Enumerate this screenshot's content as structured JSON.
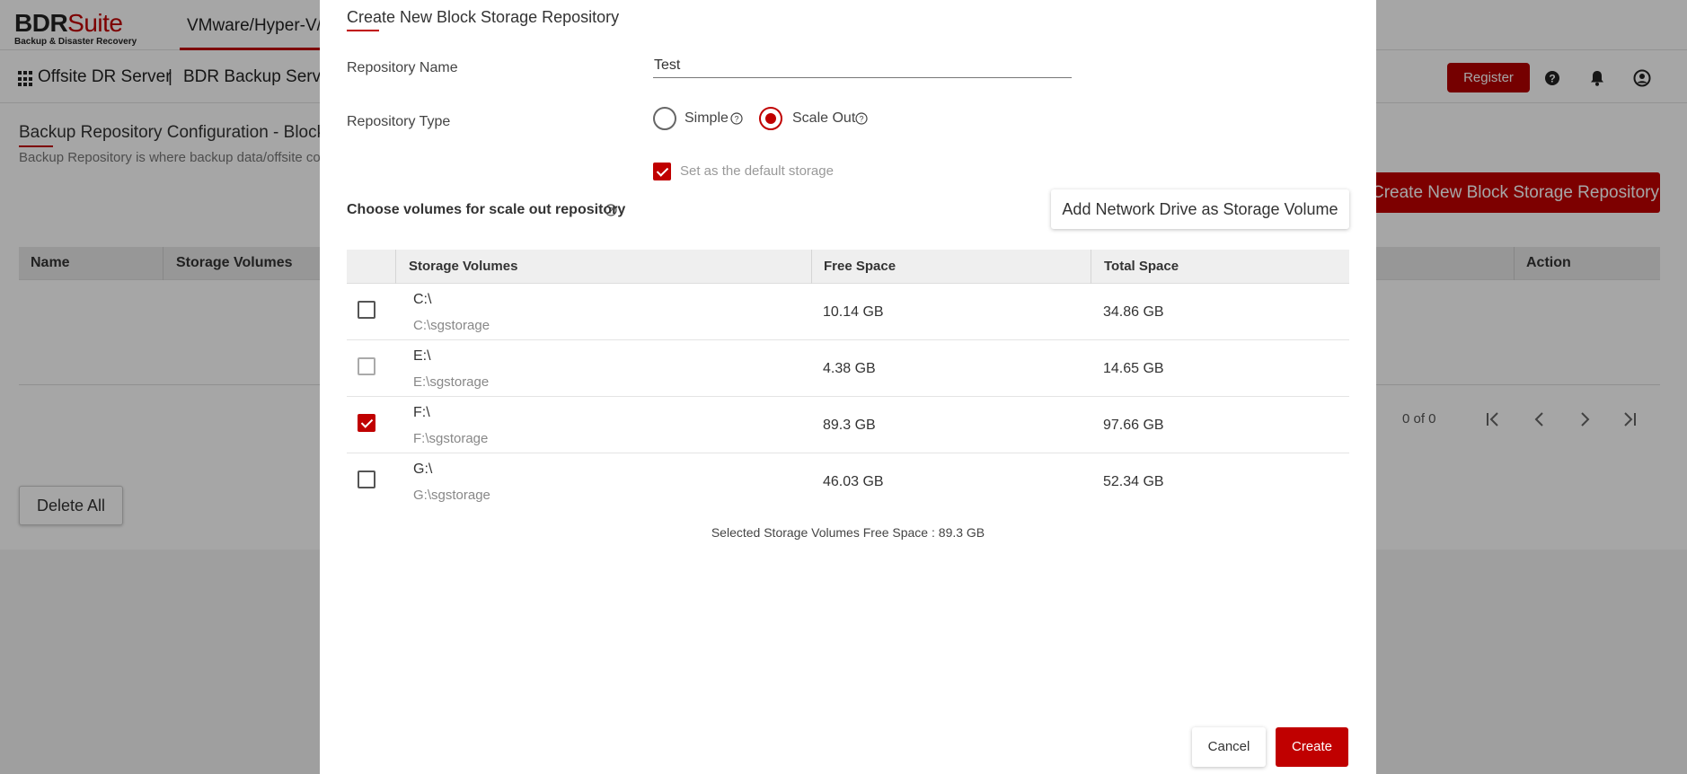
{
  "app": {
    "logo_main": "BDR",
    "logo_suite": "Suite",
    "logo_sub": "Backup & Disaster Recovery",
    "main_tab": "VMware/Hyper-V/W"
  },
  "subbar": {
    "crumb_1": "Offsite DR Server",
    "separator": "|",
    "crumb_2": "BDR Backup Servers",
    "register_label": "Register"
  },
  "background_page": {
    "title": "Backup Repository Configuration - Block Sto",
    "description": "Backup Repository is where backup data/offsite cop",
    "create_button_label": "Create New Block Storage Repository",
    "table_headers": [
      "Name",
      "Storage Volumes",
      "Action"
    ],
    "pager_count": "0 of 0",
    "delete_all_label": "Delete All"
  },
  "dialog": {
    "title": "Create New Block Storage Repository",
    "repository_name_label": "Repository Name",
    "repository_name_value": "Test",
    "repository_type_label": "Repository Type",
    "type_options": [
      {
        "label": "Simple",
        "selected": false
      },
      {
        "label": "Scale Out",
        "selected": true
      }
    ],
    "default_storage_label": "Set as the default storage",
    "default_storage_checked": true,
    "choose_volumes_label": "Choose volumes for scale out repository",
    "add_network_drive_label": "Add Network Drive as Storage Volume",
    "table_headers": {
      "storage_volumes": "Storage Volumes",
      "free_space": "Free Space",
      "total_space": "Total Space"
    },
    "volumes": [
      {
        "drive": "C:\\",
        "path": "C:\\sgstorage",
        "free": "10.14 GB",
        "total": "34.86 GB",
        "checked": false
      },
      {
        "drive": "E:\\",
        "path": "E:\\sgstorage",
        "free": "4.38 GB",
        "total": "14.65 GB",
        "checked": false
      },
      {
        "drive": "F:\\",
        "path": "F:\\sgstorage",
        "free": "89.3 GB",
        "total": "97.66 GB",
        "checked": true
      },
      {
        "drive": "G:\\",
        "path": "G:\\sgstorage",
        "free": "46.03 GB",
        "total": "52.34 GB",
        "checked": false
      }
    ],
    "selected_free_label": "Selected Storage Volumes Free Space : ",
    "selected_free_value": "89.3 GB",
    "cancel_label": "Cancel",
    "create_label": "Create"
  },
  "colors": {
    "accent": "#c00000",
    "overlay": "rgba(0,0,0,0.35)"
  }
}
